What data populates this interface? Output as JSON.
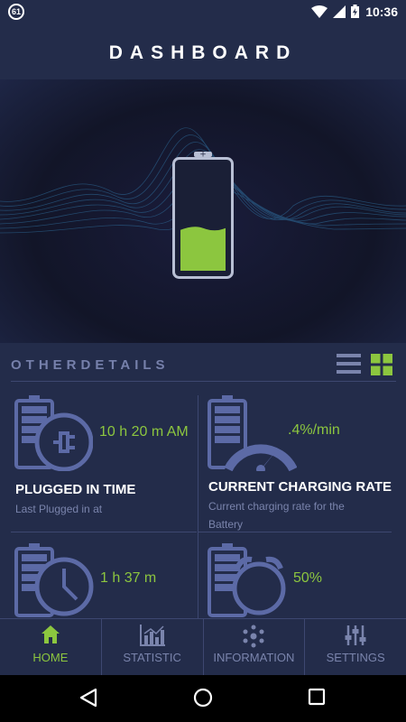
{
  "status_bar": {
    "notification_count": "61",
    "time": "10:36",
    "icons": [
      "wifi-icon",
      "signal-icon",
      "battery-charging-icon"
    ]
  },
  "header": {
    "title": "DASHBOARD"
  },
  "battery": {
    "level_fraction": 0.4,
    "fill_color": "#8cc63f"
  },
  "details": {
    "section_title": "OTHERDETAILS",
    "view_toggles": [
      "list-view-icon",
      "grid-view-icon"
    ],
    "cards": [
      {
        "icon": "battery-plug-icon",
        "value": "10 h 20 m AM",
        "title": "PLUGGED IN TIME",
        "subtitle": "Last Plugged in at"
      },
      {
        "icon": "battery-gauge-icon",
        "value": ".4%/min",
        "title": "CURRENT CHARGING RATE",
        "subtitle": "Current charging rate for the Battery"
      },
      {
        "icon": "battery-clock-icon",
        "value": "1 h 37 m"
      },
      {
        "icon": "battery-alarm-icon",
        "value": "50%"
      }
    ]
  },
  "nav": {
    "items": [
      {
        "label": "HOME",
        "icon": "home-icon",
        "active": true
      },
      {
        "label": "STATISTIC",
        "icon": "bar-chart-icon",
        "active": false
      },
      {
        "label": "INFORMATION",
        "icon": "atom-icon",
        "active": false
      },
      {
        "label": "SETTINGS",
        "icon": "sliders-icon",
        "active": false
      }
    ]
  },
  "colors": {
    "accent_green": "#8cc63f",
    "panel": "#232c4a",
    "muted_text": "#7a84ac",
    "icon_blue": "#5c6aa6"
  },
  "system_nav": [
    "back-icon",
    "home-circle-icon",
    "recents-icon"
  ]
}
